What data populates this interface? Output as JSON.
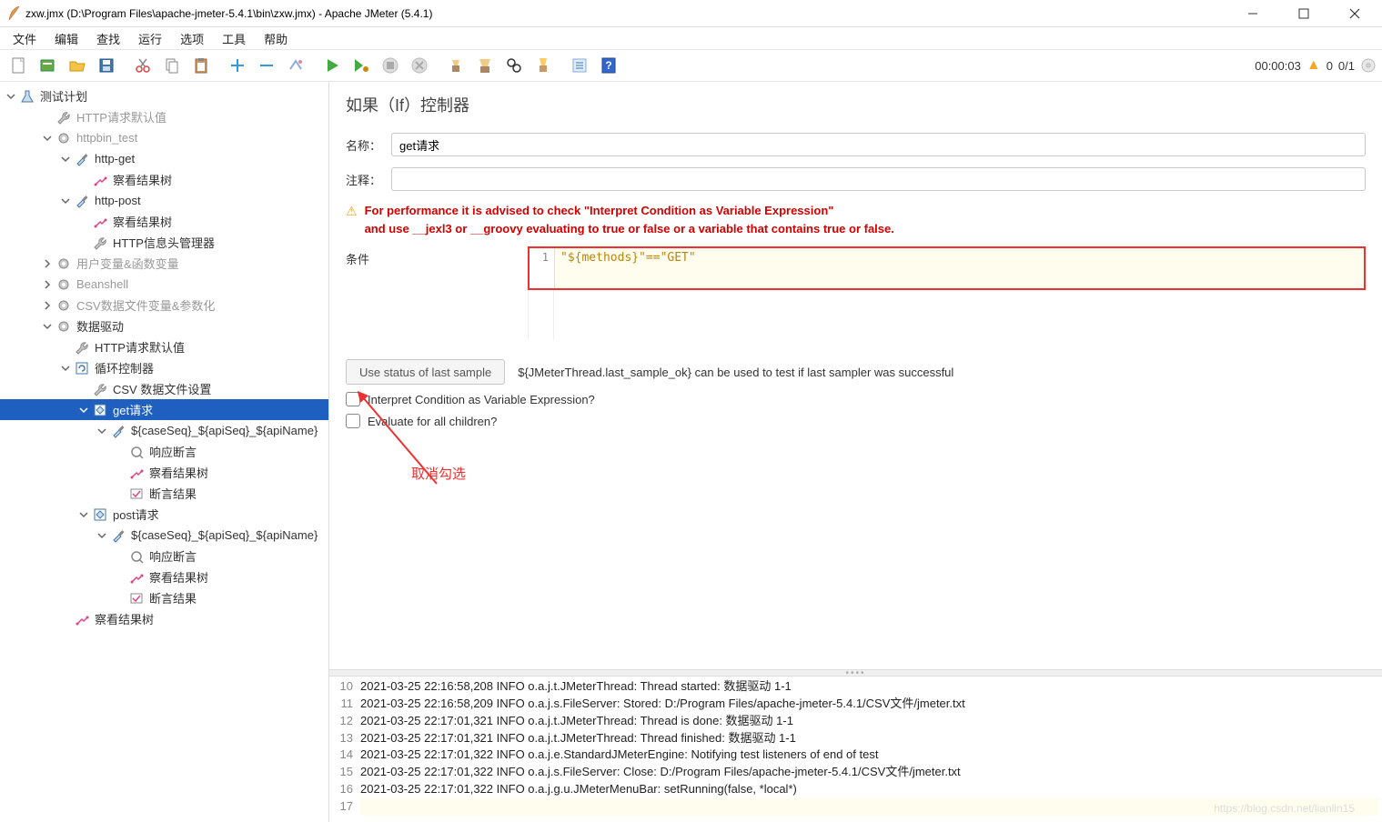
{
  "window": {
    "title": "zxw.jmx (D:\\Program Files\\apache-jmeter-5.4.1\\bin\\zxw.jmx) - Apache JMeter (5.4.1)"
  },
  "menu": [
    "文件",
    "编辑",
    "查找",
    "运行",
    "选项",
    "工具",
    "帮助"
  ],
  "toolbar_right": {
    "time": "00:00:03",
    "warn_count": "0",
    "threads": "0/1"
  },
  "tree": {
    "root": "测试计划",
    "items": [
      {
        "label": "HTTP请求默认值",
        "depth": 2,
        "dim": true,
        "icon": "wrench"
      },
      {
        "label": "httpbin_test",
        "depth": 2,
        "dim": true,
        "icon": "gear",
        "twisty": "down"
      },
      {
        "label": "http-get",
        "depth": 3,
        "icon": "dropper",
        "twisty": "down"
      },
      {
        "label": "察看结果树",
        "depth": 4,
        "icon": "tree"
      },
      {
        "label": "http-post",
        "depth": 3,
        "icon": "dropper",
        "twisty": "down"
      },
      {
        "label": "察看结果树",
        "depth": 4,
        "icon": "tree"
      },
      {
        "label": "HTTP信息头管理器",
        "depth": 4,
        "icon": "wrench"
      },
      {
        "label": "用户变量&函数变量",
        "depth": 2,
        "dim": true,
        "icon": "gear",
        "twisty": "right"
      },
      {
        "label": "Beanshell",
        "depth": 2,
        "dim": true,
        "icon": "gear",
        "twisty": "right"
      },
      {
        "label": "CSV数据文件变量&参数化",
        "depth": 2,
        "dim": true,
        "icon": "gear",
        "twisty": "right"
      },
      {
        "label": "数据驱动",
        "depth": 2,
        "icon": "gear",
        "twisty": "down"
      },
      {
        "label": "HTTP请求默认值",
        "depth": 3,
        "icon": "wrench"
      },
      {
        "label": "循环控制器",
        "depth": 3,
        "icon": "loop",
        "twisty": "down"
      },
      {
        "label": "CSV 数据文件设置",
        "depth": 4,
        "icon": "wrench"
      },
      {
        "label": "get请求",
        "depth": 4,
        "icon": "if",
        "twisty": "down",
        "selected": true
      },
      {
        "label": "${caseSeq}_${apiSeq}_${apiName}",
        "depth": 5,
        "icon": "dropper",
        "twisty": "down"
      },
      {
        "label": "响应断言",
        "depth": 6,
        "icon": "assert"
      },
      {
        "label": "察看结果树",
        "depth": 6,
        "icon": "tree"
      },
      {
        "label": "断言结果",
        "depth": 6,
        "icon": "assert-res"
      },
      {
        "label": "post请求",
        "depth": 4,
        "icon": "if",
        "twisty": "down"
      },
      {
        "label": "${caseSeq}_${apiSeq}_${apiName}",
        "depth": 5,
        "icon": "dropper",
        "twisty": "down"
      },
      {
        "label": "响应断言",
        "depth": 6,
        "icon": "assert"
      },
      {
        "label": "察看结果树",
        "depth": 6,
        "icon": "tree"
      },
      {
        "label": "断言结果",
        "depth": 6,
        "icon": "assert-res"
      },
      {
        "label": "察看结果树",
        "depth": 3,
        "icon": "tree"
      }
    ]
  },
  "panel": {
    "title": "如果（If）控制器",
    "name_label": "名称：",
    "name_value": "get请求",
    "comment_label": "注释：",
    "comment_value": "",
    "warning_line1": "For performance it is advised to check \"Interpret Condition as Variable Expression\"",
    "warning_line2": "and use __jexl3 or __groovy evaluating to true or false or a variable that contains true or false.",
    "condition_label": "条件",
    "condition_code": "\"${methods}\"==\"GET\"",
    "gutter": "1",
    "status_btn": "Use status of last sample",
    "status_hint": "${JMeterThread.last_sample_ok} can be used to test if last sampler was successful",
    "check1": "Interpret Condition as Variable Expression?",
    "check2": "Evaluate for all children?",
    "annotation": "取消勾选"
  },
  "log": [
    {
      "n": "10",
      "t": "2021-03-25 22:16:58,208 INFO o.a.j.t.JMeterThread: Thread started: 数据驱动 1-1"
    },
    {
      "n": "11",
      "t": "2021-03-25 22:16:58,209 INFO o.a.j.s.FileServer: Stored: D:/Program Files/apache-jmeter-5.4.1/CSV文件/jmeter.txt"
    },
    {
      "n": "12",
      "t": "2021-03-25 22:17:01,321 INFO o.a.j.t.JMeterThread: Thread is done: 数据驱动 1-1"
    },
    {
      "n": "13",
      "t": "2021-03-25 22:17:01,321 INFO o.a.j.t.JMeterThread: Thread finished: 数据驱动 1-1"
    },
    {
      "n": "14",
      "t": "2021-03-25 22:17:01,322 INFO o.a.j.e.StandardJMeterEngine: Notifying test listeners of end of test"
    },
    {
      "n": "15",
      "t": "2021-03-25 22:17:01,322 INFO o.a.j.s.FileServer: Close: D:/Program Files/apache-jmeter-5.4.1/CSV文件/jmeter.txt"
    },
    {
      "n": "16",
      "t": "2021-03-25 22:17:01,322 INFO o.a.j.g.u.JMeterMenuBar: setRunning(false, *local*)"
    },
    {
      "n": "17",
      "t": "",
      "hl": true
    }
  ],
  "watermark": "https://blog.csdn.net/lianlin15"
}
